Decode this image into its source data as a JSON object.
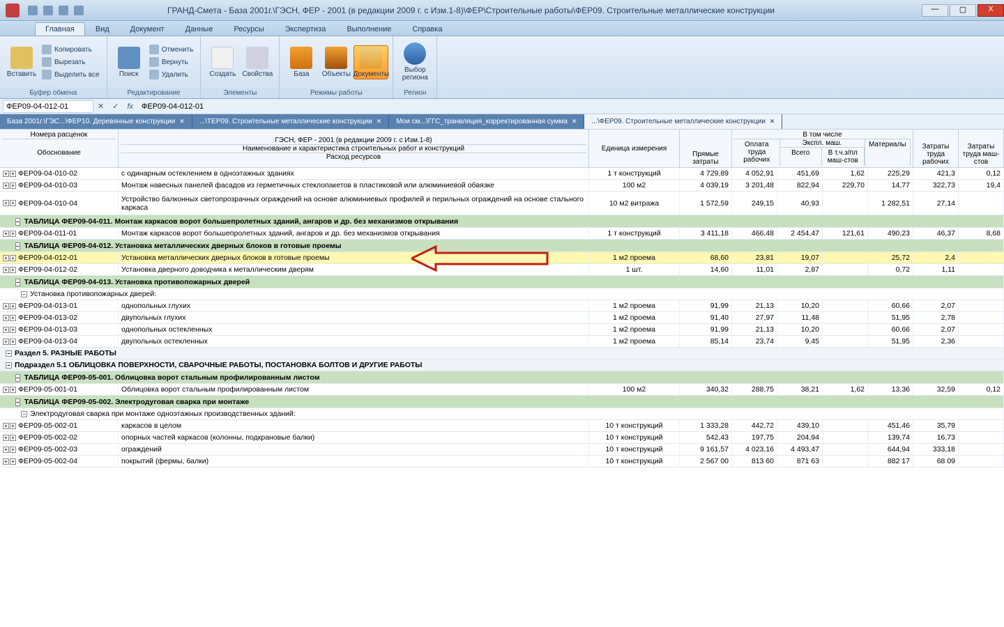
{
  "title": "ГРАНД-Смета - База 2001г.\\ГЭСН, ФЕР - 2001 (в редакции 2009 г. с Изм.1-8)\\ФЕР\\Строительные работы\\ФЕР09. Строительные металлические конструкции",
  "ribbon": {
    "tabs": [
      "Главная",
      "Вид",
      "Документ",
      "Данные",
      "Ресурсы",
      "Экспертиза",
      "Выполнение",
      "Справка"
    ],
    "active": 0,
    "groups": {
      "clipboard": {
        "label": "Буфер обмена",
        "paste": "Вставить",
        "copy": "Копировать",
        "cut": "Вырезать",
        "select": "Выделить все"
      },
      "edit": {
        "label": "Редактирование",
        "search": "Поиск",
        "undo": "Отменить",
        "redo": "Вернуть",
        "delete": "Удалить"
      },
      "elements": {
        "label": "Элементы",
        "create": "Создать",
        "props": "Свойства"
      },
      "modes": {
        "label": "Режимы работы",
        "base": "База",
        "objects": "Объекты",
        "docs": "Документы"
      },
      "region": {
        "label": "Регион",
        "choose": "Выбор региона"
      }
    }
  },
  "formula": {
    "name": "ФЕР09-04-012-01",
    "value": "ФЕР09-04-012-01",
    "fx": "fx"
  },
  "docTabs": [
    {
      "label": "База 2001г.\\ГЭС...\\ФЕР10. Деревянные конструкции",
      "active": false
    },
    {
      "label": "...\\ТЕР09. Строительные металлические конструкции",
      "active": false
    },
    {
      "label": "Мои см...\\ГГС_транвляция_корректированная сумма",
      "active": false
    },
    {
      "label": "...\\ФЕР09. Строительные металлические конструкции",
      "active": true
    }
  ],
  "headers": {
    "code": "Номера расценок",
    "justification": "Обоснование",
    "name": "Наименование и характеристика строительных работ и конструкций",
    "resource": "Расход ресурсов",
    "base_name": "ГЭСН, ФЕР - 2001 (в редакции 2009 г. с Изм.1-8)",
    "unit": "Единица измерения",
    "direct": "Прямые затраты",
    "including": "В том числе",
    "labor": "Оплата труда рабочих",
    "mach": "Экспл. маш.",
    "mach_total": "Всего",
    "mach_wage": "В т.ч.з/пл маш-стов",
    "materials": "Материалы",
    "labor_hours": "Затраты труда рабочих",
    "mach_hours": "Затраты труда маш-стов"
  },
  "rows": [
    {
      "type": "data",
      "code": "ФЕР09-04-010-02",
      "name": "с одинарным остеклением в одноэтажных зданиях",
      "unit": "1 т конструкций",
      "v": [
        "4 729,89",
        "4 052,91",
        "451,69",
        "1,62",
        "225,29",
        "421,3",
        "0,12"
      ]
    },
    {
      "type": "data",
      "code": "ФЕР09-04-010-03",
      "name": "Монтаж навесных панелей фасадов из герметичных стеклопакетов в пластиковой или алюминиевой обвязке",
      "unit": "100 м2",
      "v": [
        "4 039,19",
        "3 201,48",
        "822,94",
        "229,70",
        "14,77",
        "322,73",
        "19,4"
      ]
    },
    {
      "type": "data",
      "tall": true,
      "code": "ФЕР09-04-010-04",
      "name": "Устройство балконных светопрозрачных ограждений на основе алюминиевых профилей и перильных ограждений на основе стального каркаса",
      "unit": "10 м2 витража",
      "v": [
        "1 572,59",
        "249,15",
        "40,93",
        "",
        "1 282,51",
        "27,14",
        ""
      ]
    },
    {
      "type": "header",
      "text": "ТАБЛИЦА ФЕР09-04-011. Монтаж каркасов ворот большепролетных зданий, ангаров и др. без механизмов открывания"
    },
    {
      "type": "data",
      "code": "ФЕР09-04-011-01",
      "name": "Монтаж каркасов ворот большепролетных зданий, ангаров и др. без механизмов открывания",
      "unit": "1 т конструкций",
      "v": [
        "3 411,18",
        "466,48",
        "2 454,47",
        "121,61",
        "490,23",
        "46,37",
        "8,68"
      ]
    },
    {
      "type": "header",
      "text": "ТАБЛИЦА ФЕР09-04-012. Установка металлических дверных блоков в готовые проемы"
    },
    {
      "type": "data",
      "highlight": true,
      "code": "ФЕР09-04-012-01",
      "name": "Установка металлических дверных блоков в готовые проемы",
      "unit": "1 м2 проема",
      "v": [
        "68,60",
        "23,81",
        "19,07",
        "",
        "25,72",
        "2,4",
        ""
      ]
    },
    {
      "type": "data",
      "code": "ФЕР09-04-012-02",
      "name": "Установка дверного доводчика к металлическим дверям",
      "unit": "1 шт.",
      "v": [
        "14,60",
        "11,01",
        "2,87",
        "",
        "0,72",
        "1,11",
        ""
      ]
    },
    {
      "type": "header",
      "text": "ТАБЛИЦА ФЕР09-04-013. Установка противопожарных дверей"
    },
    {
      "type": "sub",
      "text": "Установка противопожарных дверей:"
    },
    {
      "type": "data",
      "code": "ФЕР09-04-013-01",
      "name": "однопольных глухих",
      "unit": "1 м2 проема",
      "v": [
        "91,99",
        "21,13",
        "10,20",
        "",
        "60,66",
        "2,07",
        ""
      ]
    },
    {
      "type": "data",
      "code": "ФЕР09-04-013-02",
      "name": "двупольных глухих",
      "unit": "1 м2 проема",
      "v": [
        "91,40",
        "27,97",
        "11,48",
        "",
        "51,95",
        "2,78",
        ""
      ]
    },
    {
      "type": "data",
      "code": "ФЕР09-04-013-03",
      "name": "однопольных остекленных",
      "unit": "1 м2 проема",
      "v": [
        "91,99",
        "21,13",
        "10,20",
        "",
        "60,66",
        "2,07",
        ""
      ]
    },
    {
      "type": "data",
      "code": "ФЕР09-04-013-04",
      "name": "двупольных остекленных",
      "unit": "1 м2 проема",
      "v": [
        "85,14",
        "23,74",
        "9,45",
        "",
        "51,95",
        "2,36",
        ""
      ]
    },
    {
      "type": "section",
      "text": "Раздел 5. РАЗНЫЕ РАБОТЫ"
    },
    {
      "type": "section",
      "text": "Подраздел 5.1 ОБЛИЦОВКА ПОВЕРХНОСТИ, СВАРОЧНЫЕ РАБОТЫ, ПОСТАНОВКА БОЛТОВ И ДРУГИЕ РАБОТЫ"
    },
    {
      "type": "header",
      "text": "ТАБЛИЦА ФЕР09-05-001. Облицовка ворот стальным профилированным листом"
    },
    {
      "type": "data",
      "code": "ФЕР09-05-001-01",
      "name": "Облицовка ворот стальным профилированным листом",
      "unit": "100 м2",
      "v": [
        "340,32",
        "288,75",
        "38,21",
        "1,62",
        "13,36",
        "32,59",
        "0,12"
      ]
    },
    {
      "type": "header",
      "text": "ТАБЛИЦА ФЕР09-05-002. Электродуговая сварка при монтаже"
    },
    {
      "type": "sub",
      "text": "Электродуговая сварка при монтаже одноэтажных производственных зданий:"
    },
    {
      "type": "data",
      "code": "ФЕР09-05-002-01",
      "name": "каркасов в целом",
      "unit": "10 т конструкций",
      "v": [
        "1 333,28",
        "442,72",
        "439,10",
        "",
        "451,46",
        "35,79",
        ""
      ]
    },
    {
      "type": "data",
      "code": "ФЕР09-05-002-02",
      "name": "опорных частей каркасов (колонны, подкрановые балки)",
      "unit": "10 т конструкций",
      "v": [
        "542,43",
        "197,75",
        "204,94",
        "",
        "139,74",
        "16,73",
        ""
      ]
    },
    {
      "type": "data",
      "code": "ФЕР09-05-002-03",
      "name": "ограждений",
      "unit": "10 т конструкций",
      "v": [
        "9 161,57",
        "4 023,16",
        "4 493,47",
        "",
        "644,94",
        "333,18",
        ""
      ]
    },
    {
      "type": "data",
      "code": "ФЕР09-05-002-04",
      "name": "покрытий (фермы, балки)",
      "unit": "10 т конструкций",
      "v": [
        "2 567 00",
        "813 60",
        "871 63",
        "",
        "882 17",
        "68 09",
        ""
      ]
    }
  ]
}
